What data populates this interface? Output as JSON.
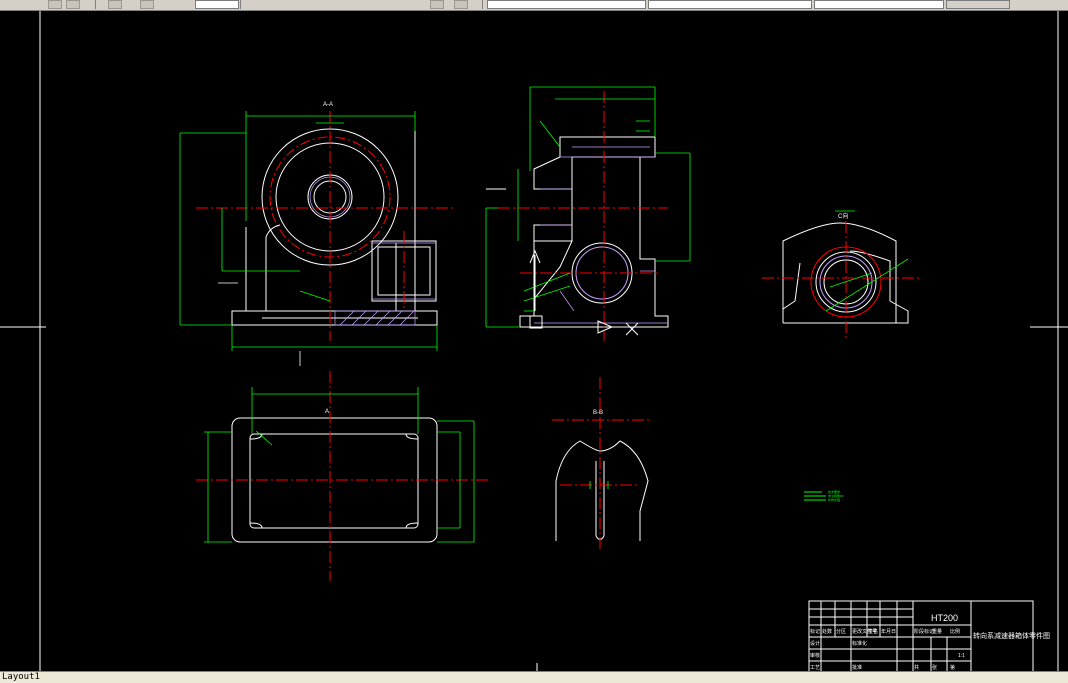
{
  "app": {
    "layout_tab_label": "Layout1"
  },
  "toolbar": {
    "icons": [
      "layer-icon",
      "layer-manager-icon",
      "zoom-icon",
      "pan-icon",
      "properties-icon"
    ],
    "fields": [
      "",
      "",
      "",
      ""
    ]
  },
  "drawing": {
    "material": "HT200",
    "title": "转向系减速器箱体零件图",
    "scale_text": "1:1",
    "title_block_labels": {
      "design": "设计",
      "check": "审核",
      "process": "工艺",
      "standard": "标准化",
      "approve": "批准",
      "mark": "标记",
      "count": "处数",
      "zone": "分区",
      "doc_no": "更改文件号",
      "sign": "签名",
      "date": "年月日",
      "stage": "阶段标记",
      "weight": "重量",
      "scale": "比例",
      "sheet_total": "共",
      "sheet": "张",
      "sheet_no": "第"
    },
    "section_labels": [
      "A-A",
      "B-B",
      "C向",
      "A"
    ],
    "notes": [
      "技术要求",
      "未注圆角R3",
      "时效处理"
    ]
  },
  "colors": {
    "outline": "#ffffff",
    "dimension": "#00ff00",
    "centerline": "#ff0000",
    "hatch": "#c8a0ff",
    "background": "#000000"
  }
}
